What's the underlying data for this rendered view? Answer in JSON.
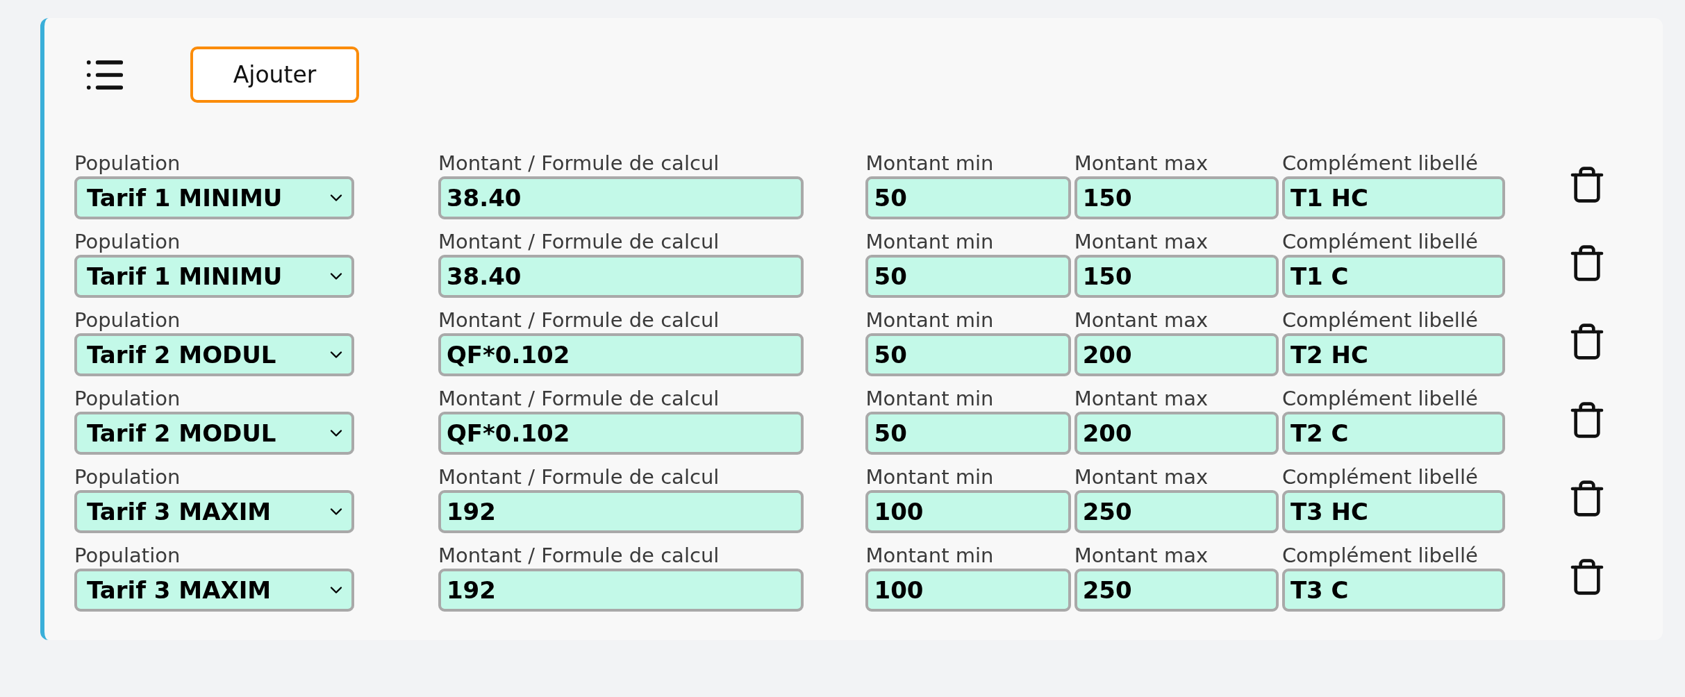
{
  "toolbar": {
    "add_button": "Ajouter"
  },
  "rows": [
    {
      "population_label": "Population",
      "population": "Tarif 1 MINIMU",
      "amount_label": "Montant / Formule de calcul",
      "amount": "38.40",
      "min_label": "Montant min",
      "min": "50",
      "max_label": "Montant max",
      "max": "150",
      "complement_label": "Complément libellé",
      "complement": "T1 HC"
    },
    {
      "population_label": "Population",
      "population": "Tarif 1 MINIMU",
      "amount_label": "Montant / Formule de calcul",
      "amount": "38.40",
      "min_label": "Montant min",
      "min": "50",
      "max_label": "Montant max",
      "max": "150",
      "complement_label": "Complément libellé",
      "complement": "T1 C"
    },
    {
      "population_label": "Population",
      "population": "Tarif 2 MODUL",
      "amount_label": "Montant / Formule de calcul",
      "amount": "QF*0.102",
      "min_label": "Montant min",
      "min": "50",
      "max_label": "Montant max",
      "max": "200",
      "complement_label": "Complément libellé",
      "complement": "T2 HC"
    },
    {
      "population_label": "Population",
      "population": "Tarif 2 MODUL",
      "amount_label": "Montant / Formule de calcul",
      "amount": "QF*0.102",
      "min_label": "Montant min",
      "min": "50",
      "max_label": "Montant max",
      "max": "200",
      "complement_label": "Complément libellé",
      "complement": "T2 C"
    },
    {
      "population_label": "Population",
      "population": "Tarif 3 MAXIM",
      "amount_label": "Montant / Formule de calcul",
      "amount": "192",
      "min_label": "Montant min",
      "min": "100",
      "max_label": "Montant max",
      "max": "250",
      "complement_label": "Complément libellé",
      "complement": "T3 HC"
    },
    {
      "population_label": "Population",
      "population": "Tarif 3 MAXIM",
      "amount_label": "Montant / Formule de calcul",
      "amount": "192",
      "min_label": "Montant min",
      "min": "100",
      "max_label": "Montant max",
      "max": "250",
      "complement_label": "Complément libellé",
      "complement": "T3 C"
    }
  ]
}
